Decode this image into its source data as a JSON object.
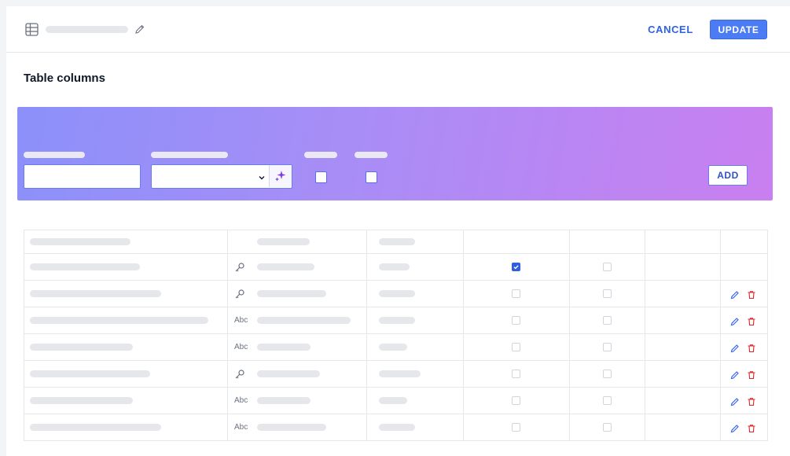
{
  "header": {
    "cancel_label": "CANCEL",
    "update_label": "UPDATE",
    "icon": "table-icon",
    "edit_icon": "pencil-icon"
  },
  "section": {
    "title": "Table columns"
  },
  "add_form": {
    "add_label": "ADD",
    "magic_icon": "sparkles-icon"
  },
  "colors": {
    "accent": "#2f62e4",
    "update_bg": "#4b7cf3",
    "banner_start": "#8c90fa",
    "banner_end": "#c97ff0",
    "delete": "#dc2626"
  },
  "columns": {
    "rows": [
      {
        "type": "key",
        "type_label": "",
        "first_checked": true,
        "has_actions": false
      },
      {
        "type": "key",
        "type_label": "",
        "first_checked": false,
        "has_actions": true
      },
      {
        "type": "text",
        "type_label": "Abc",
        "first_checked": false,
        "has_actions": true
      },
      {
        "type": "text",
        "type_label": "Abc",
        "first_checked": false,
        "has_actions": true
      },
      {
        "type": "key",
        "type_label": "",
        "first_checked": false,
        "has_actions": true
      },
      {
        "type": "text",
        "type_label": "Abc",
        "first_checked": false,
        "has_actions": true
      },
      {
        "type": "text",
        "type_label": "Abc",
        "first_checked": false,
        "has_actions": true
      }
    ]
  }
}
